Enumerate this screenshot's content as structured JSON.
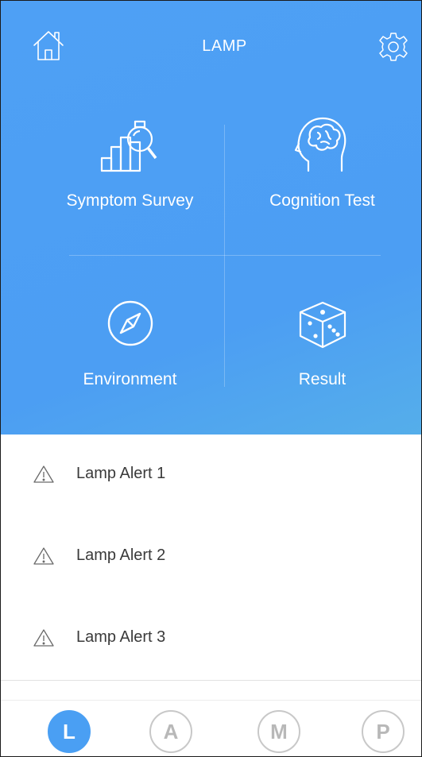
{
  "header": {
    "title": "LAMP",
    "home_icon": "home-icon",
    "settings_icon": "gear-icon"
  },
  "tiles": [
    {
      "label": "Symptom Survey",
      "icon": "bar-chart-search-icon"
    },
    {
      "label": "Cognition Test",
      "icon": "brain-head-icon"
    },
    {
      "label": "Environment",
      "icon": "compass-icon"
    },
    {
      "label": "Result",
      "icon": "dice-icon"
    }
  ],
  "alerts": [
    {
      "label": "Lamp Alert 1",
      "icon": "warning-icon"
    },
    {
      "label": "Lamp Alert 2",
      "icon": "warning-icon"
    },
    {
      "label": "Lamp Alert 3",
      "icon": "warning-icon"
    }
  ],
  "bottom_nav": {
    "items": [
      {
        "label": "L",
        "active": true
      },
      {
        "label": "A",
        "active": false
      },
      {
        "label": "M",
        "active": false
      },
      {
        "label": "P",
        "active": false
      }
    ]
  },
  "colors": {
    "primary": "#4a9ff3",
    "inactive": "#b8b8b8",
    "text": "#3a3a3a"
  }
}
